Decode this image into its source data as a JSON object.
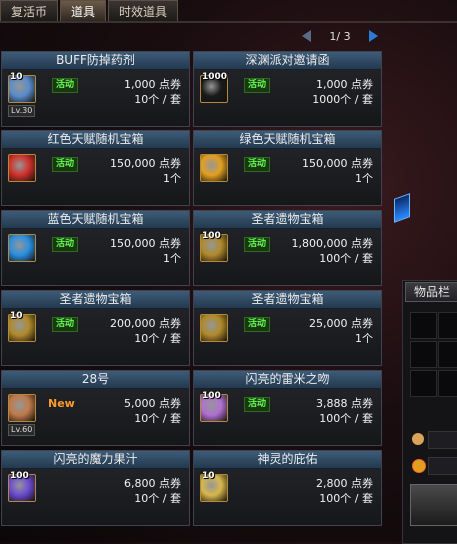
{
  "tabs": [
    {
      "label": "复活币",
      "active": false
    },
    {
      "label": "道具",
      "active": true
    },
    {
      "label": "时效道具",
      "active": false
    }
  ],
  "pager": {
    "text": "1/ 3"
  },
  "items": [
    {
      "title": "BUFF防掉药剂",
      "qty": "10",
      "level": "Lv.30",
      "badge": "活动",
      "price": "1,000 点券",
      "unit": "10个 / 套",
      "icon": "potion-icon",
      "color": "#5a8cc9"
    },
    {
      "title": "深渊派对邀请函",
      "qty": "1000",
      "level": "",
      "badge": "活动",
      "price": "1,000 点券",
      "unit": "1000个 / 套",
      "icon": "invitation-icon",
      "color": "#1a1a1a"
    },
    {
      "title": "红色天赋随机宝箱",
      "qty": "",
      "level": "",
      "badge": "活动",
      "price": "150,000 点券",
      "unit": "1个",
      "icon": "red-box-icon",
      "color": "#d0302a"
    },
    {
      "title": "绿色天赋随机宝箱",
      "qty": "",
      "level": "",
      "badge": "活动",
      "price": "150,000 点券",
      "unit": "1个",
      "icon": "green-box-icon",
      "color": "#e2a020"
    },
    {
      "title": "蓝色天赋随机宝箱",
      "qty": "",
      "level": "",
      "badge": "活动",
      "price": "150,000 点券",
      "unit": "1个",
      "icon": "blue-box-icon",
      "color": "#2a8fe0"
    },
    {
      "title": "圣者遗物宝箱",
      "qty": "100",
      "level": "",
      "badge": "活动",
      "price": "1,800,000 点券",
      "unit": "100个 / 套",
      "icon": "relic-box-icon",
      "color": "#b08a2a"
    },
    {
      "title": "圣者遗物宝箱",
      "qty": "10",
      "level": "",
      "badge": "活动",
      "price": "200,000 点券",
      "unit": "10个 / 套",
      "icon": "relic-box-icon",
      "color": "#b08a2a"
    },
    {
      "title": "圣者遗物宝箱",
      "qty": "",
      "level": "",
      "badge": "活动",
      "price": "25,000 点券",
      "unit": "1个",
      "icon": "relic-box-icon",
      "color": "#b08a2a"
    },
    {
      "title": "28号",
      "qty": "",
      "level": "Lv.60",
      "badge": "New",
      "price": "5,000 点券",
      "unit": "10个 / 套",
      "icon": "character-icon",
      "color": "#c07a4a"
    },
    {
      "title": "闪亮的雷米之吻",
      "qty": "100",
      "level": "",
      "badge": "活动",
      "price": "3,888 点券",
      "unit": "100个 / 套",
      "icon": "kiss-icon",
      "color": "#b070d0"
    },
    {
      "title": "闪亮的魔力果汁",
      "qty": "100",
      "level": "",
      "badge": "",
      "price": "6,800 点券",
      "unit": "10个 / 套",
      "icon": "juice-icon",
      "color": "#6a4ad0"
    },
    {
      "title": "神灵的庇佑",
      "qty": "10",
      "level": "",
      "badge": "",
      "price": "2,800 点券",
      "unit": "100个 / 套",
      "icon": "blessing-icon",
      "color": "#d8b84a"
    }
  ],
  "side": {
    "title": "物品栏"
  }
}
